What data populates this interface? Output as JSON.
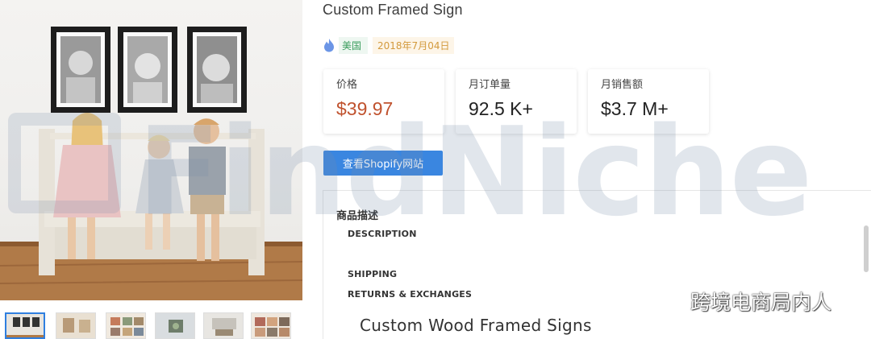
{
  "product": {
    "title": "Custom Framed Sign",
    "country": "美国",
    "date": "2018年7月04日",
    "icon": "fire-icon"
  },
  "stats": [
    {
      "label": "价格",
      "value": "$39.97"
    },
    {
      "label": "月订单量",
      "value": "92.5 K+"
    },
    {
      "label": "月销售额",
      "value": "$3.7 M+"
    }
  ],
  "actions": {
    "view_shop_label": "查看Shopify网站"
  },
  "description": {
    "heading": "商品描述",
    "lines": [
      "DESCRIPTION",
      "SHIPPING",
      "RETURNS & EXCHANGES"
    ],
    "big_title": "Custom Wood Framed Signs"
  },
  "gallery": {
    "thumbnail_count": 6,
    "active_index": 0
  },
  "watermark": {
    "text": "FindNiche",
    "wechat_account": "跨境电商局内人"
  },
  "colors": {
    "accent": "#3a86e0",
    "price": "#c0522e",
    "country_tag": "#3a9c5c",
    "date_tag": "#d39a3d"
  }
}
